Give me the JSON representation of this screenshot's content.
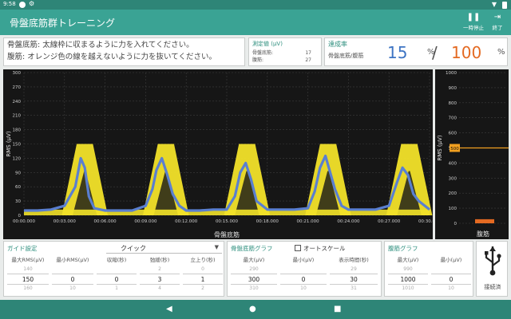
{
  "status_bar": {
    "time": "9:58"
  },
  "app_bar": {
    "title": "骨盤底筋群トレーニング",
    "pause_label": "一時停止",
    "exit_label": "終了"
  },
  "instructions": {
    "line1": "骨盤底筋: 太線枠に収まるように力を入れてください。",
    "line2": "腹筋: オレンジ色の線を越えないように力を抜いてください。"
  },
  "measured": {
    "title": "測定値 (μV)",
    "rows": [
      {
        "label": "骨盤底筋:",
        "value": "17"
      },
      {
        "label": "腹筋:",
        "value": "27"
      }
    ]
  },
  "achievement": {
    "title": "達成率",
    "subtitle": "骨盤底筋/腹筋",
    "pelvic": "15",
    "abdominal": "100",
    "percent": "%",
    "slash": "/",
    "pelvic_color": "#3d74c3",
    "abdominal_color": "#e46a22"
  },
  "guide_settings": {
    "title": "ガイド設定",
    "preset": "クイック",
    "columns": [
      {
        "label": "最大RMS(μV)",
        "prev": "140",
        "value": "150",
        "next": "160"
      },
      {
        "label": "最小RMS(μV)",
        "prev": "",
        "value": "0",
        "next": "10"
      },
      {
        "label": "収縮(秒)",
        "prev": "",
        "value": "0",
        "next": "1"
      },
      {
        "label": "弛緩(秒)",
        "prev": "2",
        "value": "3",
        "next": "4"
      },
      {
        "label": "立上り(秒)",
        "prev": "0",
        "value": "1",
        "next": "2"
      }
    ]
  },
  "pelvic_graph": {
    "title": "骨盤底筋グラフ",
    "autoscale_label": "オートスケール",
    "columns": [
      {
        "label": "最大(μV)",
        "prev": "290",
        "value": "300",
        "next": "310"
      },
      {
        "label": "最小(μV)",
        "prev": "",
        "value": "0",
        "next": "10"
      },
      {
        "label": "表示時間(秒)",
        "prev": "29",
        "value": "30",
        "next": "31"
      }
    ]
  },
  "abdominal_graph": {
    "title": "腹筋グラフ",
    "columns": [
      {
        "label": "最大(μV)",
        "prev": "990",
        "value": "1000",
        "next": "1010"
      },
      {
        "label": "最小(μV)",
        "prev": "",
        "value": "0",
        "next": "10"
      }
    ]
  },
  "usb": {
    "label": "接続済"
  },
  "chart_data": [
    {
      "type": "line",
      "xlabel": "骨盤底筋",
      "ylabel": "RMS (μV)",
      "ylim": [
        0,
        300
      ],
      "xlim": [
        0,
        30
      ],
      "y_ticks": [
        "300",
        "270",
        "240",
        "210",
        "180",
        "150",
        "120",
        "90",
        "60",
        "30",
        "0"
      ],
      "x_ticks": [
        "00:00.000",
        "00:03.000",
        "00:06.000",
        "00:09.000",
        "00:12.000",
        "00:15.000",
        "00:18.000",
        "00:21.000",
        "00:24.000",
        "00:27.000",
        "00:30.000"
      ],
      "guide_peaks": [
        4.5,
        10.5,
        16.5,
        22.5,
        28.5
      ],
      "guide_max": 150,
      "grid": true,
      "colors": {
        "guide": "#f2e229",
        "signal": "#5a7fd0"
      },
      "series": [
        {
          "x": [
            0,
            1,
            2,
            3,
            3.8,
            4.2,
            4.5,
            4.8,
            5.2,
            6,
            7,
            8,
            9,
            9.5,
            9.8,
            10.2,
            10.6,
            11.0,
            11.5,
            12,
            13,
            14,
            15,
            15.6,
            16.0,
            16.4,
            16.8,
            17.2,
            18,
            19,
            20,
            21,
            21.5,
            21.9,
            22.3,
            22.6,
            23.0,
            23.5,
            24,
            25,
            26,
            27,
            27.6,
            28.0,
            28.4,
            28.8,
            29.2,
            30
          ],
          "y": [
            10,
            10,
            12,
            20,
            60,
            120,
            100,
            40,
            15,
            10,
            10,
            10,
            20,
            55,
            95,
            120,
            85,
            45,
            20,
            10,
            10,
            12,
            12,
            40,
            90,
            110,
            75,
            30,
            12,
            12,
            12,
            15,
            50,
            100,
            125,
            95,
            55,
            20,
            12,
            12,
            12,
            20,
            70,
            100,
            85,
            45,
            30,
            12
          ]
        }
      ]
    },
    {
      "type": "bar",
      "xlabel": "腹筋",
      "ylabel": "RMS (μV)",
      "ylim": [
        0,
        1000
      ],
      "y_ticks": [
        "1000",
        "900",
        "800",
        "700",
        "600",
        "500",
        "400",
        "300",
        "200",
        "100",
        "0"
      ],
      "threshold": 500,
      "threshold_label": "500",
      "values": [
        27
      ],
      "colors": {
        "bar": "#e46a22",
        "threshold": "#f2a020"
      }
    }
  ]
}
